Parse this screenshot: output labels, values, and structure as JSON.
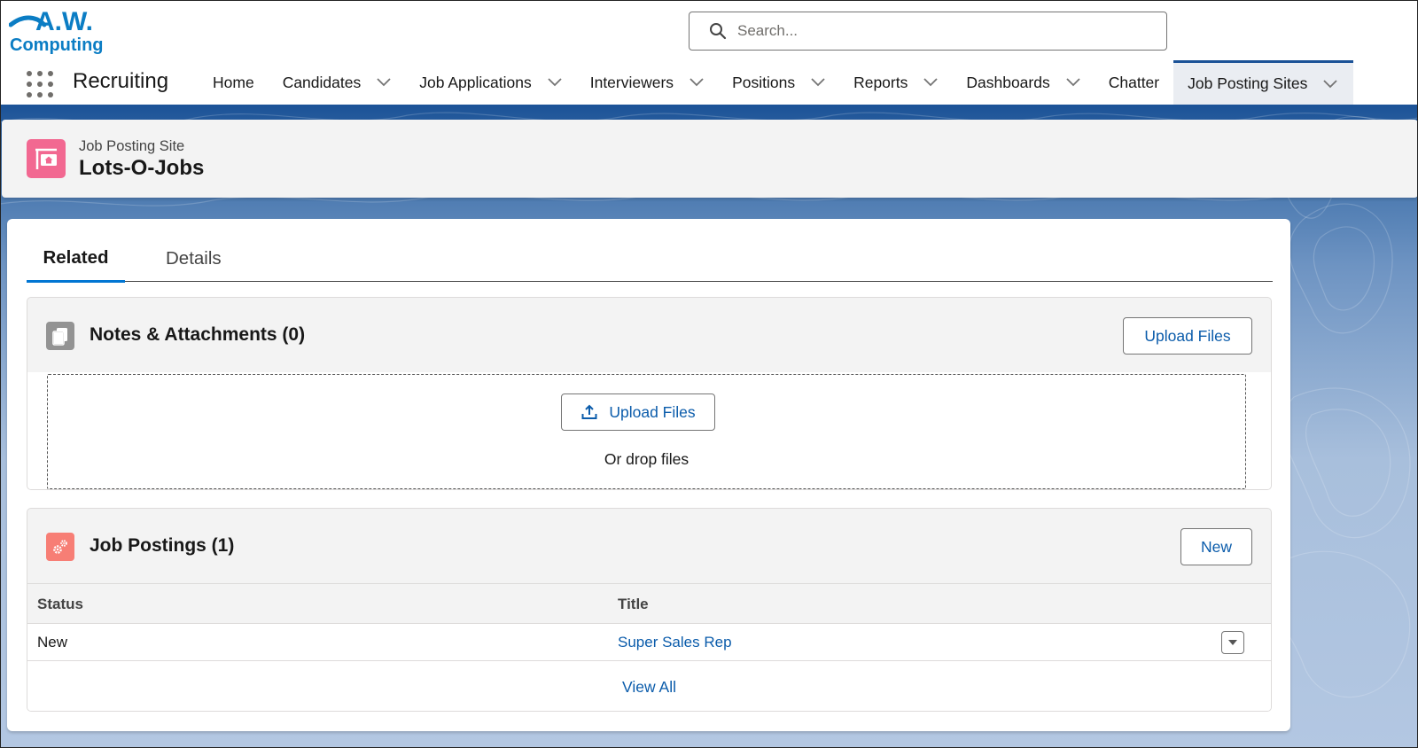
{
  "header": {
    "logo": {
      "line1": "A.W.",
      "line2": "Computing",
      "color": "#0b7dc4"
    },
    "search": {
      "placeholder": "Search...",
      "value": ""
    },
    "app_name": "Recruiting",
    "nav": [
      {
        "label": "Home",
        "has_menu": false,
        "active": false
      },
      {
        "label": "Candidates",
        "has_menu": true,
        "active": false
      },
      {
        "label": "Job Applications",
        "has_menu": true,
        "active": false
      },
      {
        "label": "Interviewers",
        "has_menu": true,
        "active": false
      },
      {
        "label": "Positions",
        "has_menu": true,
        "active": false
      },
      {
        "label": "Reports",
        "has_menu": true,
        "active": false
      },
      {
        "label": "Dashboards",
        "has_menu": true,
        "active": false
      },
      {
        "label": "Chatter",
        "has_menu": false,
        "active": false
      },
      {
        "label": "Job Posting Sites",
        "has_menu": true,
        "active": true
      }
    ]
  },
  "record": {
    "type_label": "Job Posting Site",
    "name": "Lots-O-Jobs",
    "icon": "job-posting-site-icon",
    "icon_color": "#f26891"
  },
  "tabs": [
    {
      "label": "Related",
      "active": true
    },
    {
      "label": "Details",
      "active": false
    }
  ],
  "notes_attachments": {
    "title": "Notes & Attachments (0)",
    "icon": "files-icon",
    "icon_color": "#939393",
    "upload_button": "Upload Files",
    "dropzone_button": "Upload Files",
    "drop_text": "Or drop files"
  },
  "job_postings": {
    "title": "Job Postings (1)",
    "icon": "gears-icon",
    "icon_color": "#f77e75",
    "new_button": "New",
    "columns": [
      "Status",
      "Title"
    ],
    "rows": [
      {
        "status": "New",
        "title": "Super Sales Rep"
      }
    ],
    "view_all": "View All"
  },
  "colors": {
    "brand_blue": "#0176d3",
    "link_blue": "#0b5cab",
    "header_band": "#1b5297"
  }
}
